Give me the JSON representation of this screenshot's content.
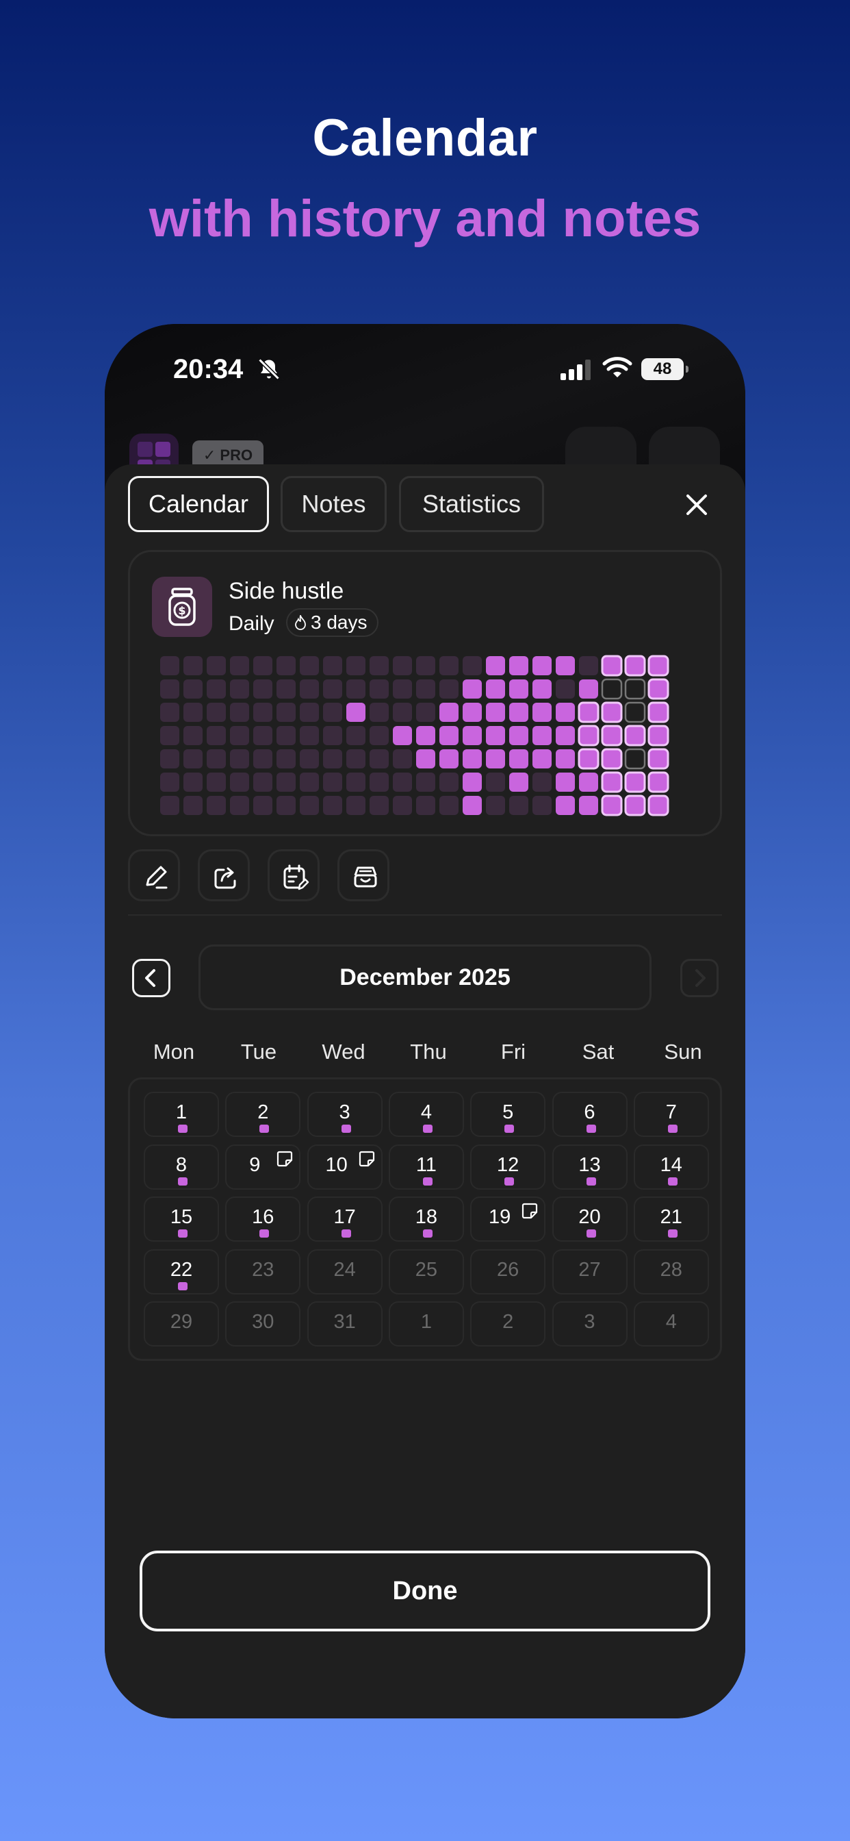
{
  "hero": {
    "title": "Calendar",
    "subtitle": "with history and notes"
  },
  "status_bar": {
    "time": "20:34",
    "battery": "48",
    "icons": [
      "bell-slash-icon",
      "cellular-signal-icon",
      "wifi-icon",
      "battery-icon"
    ]
  },
  "background_screen": {
    "badge": "✓ PRO",
    "buttons": [
      "bar-chart-icon",
      "plus-circle-icon"
    ]
  },
  "tabs": [
    {
      "label": "Calendar",
      "active": true
    },
    {
      "label": "Notes",
      "active": false
    },
    {
      "label": "Statistics",
      "active": false
    }
  ],
  "habit": {
    "icon": "money-jar-icon",
    "name": "Side hustle",
    "frequency": "Daily",
    "streak": "3 days",
    "heatmap": {
      "rows": [
        "0000000000000011110222",
        "0000000000000111101332",
        "0000000010001111112232",
        "0000000000111111112222",
        "0000000000011111112232",
        "0000000000000101011222",
        "0000000000000100011222"
      ],
      "legend": {
        "0": "past-empty",
        "1": "completed",
        "2": "completed-outlined",
        "3": "current-period-empty"
      },
      "colors": {
        "empty": "#3a2b3d",
        "filled": "#c965de",
        "outline": "#f0c8f8",
        "future": "#777777"
      }
    }
  },
  "actions": [
    {
      "name": "edit-button",
      "icon": "pencil-icon"
    },
    {
      "name": "share-button",
      "icon": "share-icon"
    },
    {
      "name": "calendar-edit-button",
      "icon": "calendar-edit-icon"
    },
    {
      "name": "archive-button",
      "icon": "archive-box-icon"
    }
  ],
  "calendar": {
    "month_label": "December 2025",
    "weekdays": [
      "Mon",
      "Tue",
      "Wed",
      "Thu",
      "Fri",
      "Sat",
      "Sun"
    ],
    "weeks": [
      [
        {
          "d": "1",
          "mark": true
        },
        {
          "d": "2",
          "mark": true
        },
        {
          "d": "3",
          "mark": true
        },
        {
          "d": "4",
          "mark": true
        },
        {
          "d": "5",
          "mark": true
        },
        {
          "d": "6",
          "mark": true
        },
        {
          "d": "7",
          "mark": true
        }
      ],
      [
        {
          "d": "8",
          "mark": true
        },
        {
          "d": "9",
          "note": true
        },
        {
          "d": "10",
          "note": true
        },
        {
          "d": "11",
          "mark": true
        },
        {
          "d": "12",
          "mark": true
        },
        {
          "d": "13",
          "mark": true
        },
        {
          "d": "14",
          "mark": true
        }
      ],
      [
        {
          "d": "15",
          "mark": true
        },
        {
          "d": "16",
          "mark": true
        },
        {
          "d": "17",
          "mark": true
        },
        {
          "d": "18",
          "mark": true
        },
        {
          "d": "19",
          "note": true
        },
        {
          "d": "20",
          "mark": true
        },
        {
          "d": "21",
          "mark": true
        }
      ],
      [
        {
          "d": "22",
          "mark": true
        },
        {
          "d": "23",
          "other": true
        },
        {
          "d": "24",
          "other": true
        },
        {
          "d": "25",
          "other": true
        },
        {
          "d": "26",
          "other": true
        },
        {
          "d": "27",
          "other": true
        },
        {
          "d": "28",
          "other": true
        }
      ],
      [
        {
          "d": "29",
          "other": true
        },
        {
          "d": "30",
          "other": true
        },
        {
          "d": "31",
          "other": true
        },
        {
          "d": "1",
          "other": true
        },
        {
          "d": "2",
          "other": true
        },
        {
          "d": "3",
          "other": true
        },
        {
          "d": "4",
          "other": true
        }
      ]
    ]
  },
  "done_label": "Done",
  "accent_color": "#c965de"
}
